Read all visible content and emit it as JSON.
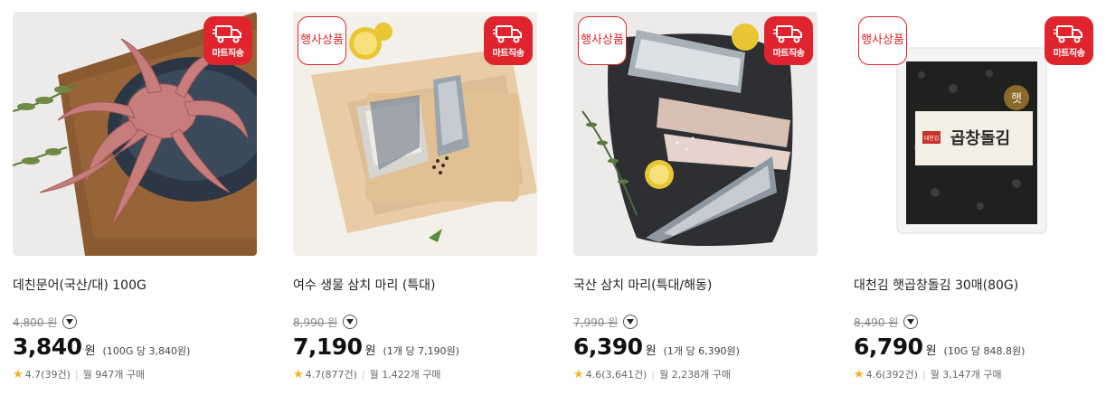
{
  "badges": {
    "event": "행사상품",
    "delivery": "마트직송"
  },
  "currency": "원",
  "products": [
    {
      "name": "데친문어(국산/대) 100G",
      "original_price": "4,800",
      "price": "3,840",
      "unit_price": "(100G 당 3,840원)",
      "rating": "4.7",
      "reviews": "(39건)",
      "monthly": "월 947개 구매",
      "event": false
    },
    {
      "name": "여수 생물 삼치 마리 (특대)",
      "original_price": "8,990",
      "price": "7,190",
      "unit_price": "(1개 당 7,190원)",
      "rating": "4.7",
      "reviews": "(877건)",
      "monthly": "월 1,422개 구매",
      "event": true
    },
    {
      "name": "국산 삼치 마리(특대/해동)",
      "original_price": "7,990",
      "price": "6,390",
      "unit_price": "(1개 당 6,390원)",
      "rating": "4.6",
      "reviews": "(3,641건)",
      "monthly": "월 2,238개 구매",
      "event": true
    },
    {
      "name": "대천김 햇곱창돌김 30매(80G)",
      "original_price": "8,490",
      "price": "6,790",
      "unit_price": "(10G 당 848.8원)",
      "rating": "4.6",
      "reviews": "(392건)",
      "monthly": "월 3,147개 구매",
      "event": true
    }
  ],
  "package_text": {
    "brand": "대천김",
    "fresh": "햇",
    "title": "곱창돌김"
  },
  "colors": {
    "accent": "#e0242e",
    "star": "#f4b21b"
  },
  "icons": {
    "truck": "truck-icon",
    "toggle": "chevron-down-icon",
    "star": "star-icon"
  }
}
